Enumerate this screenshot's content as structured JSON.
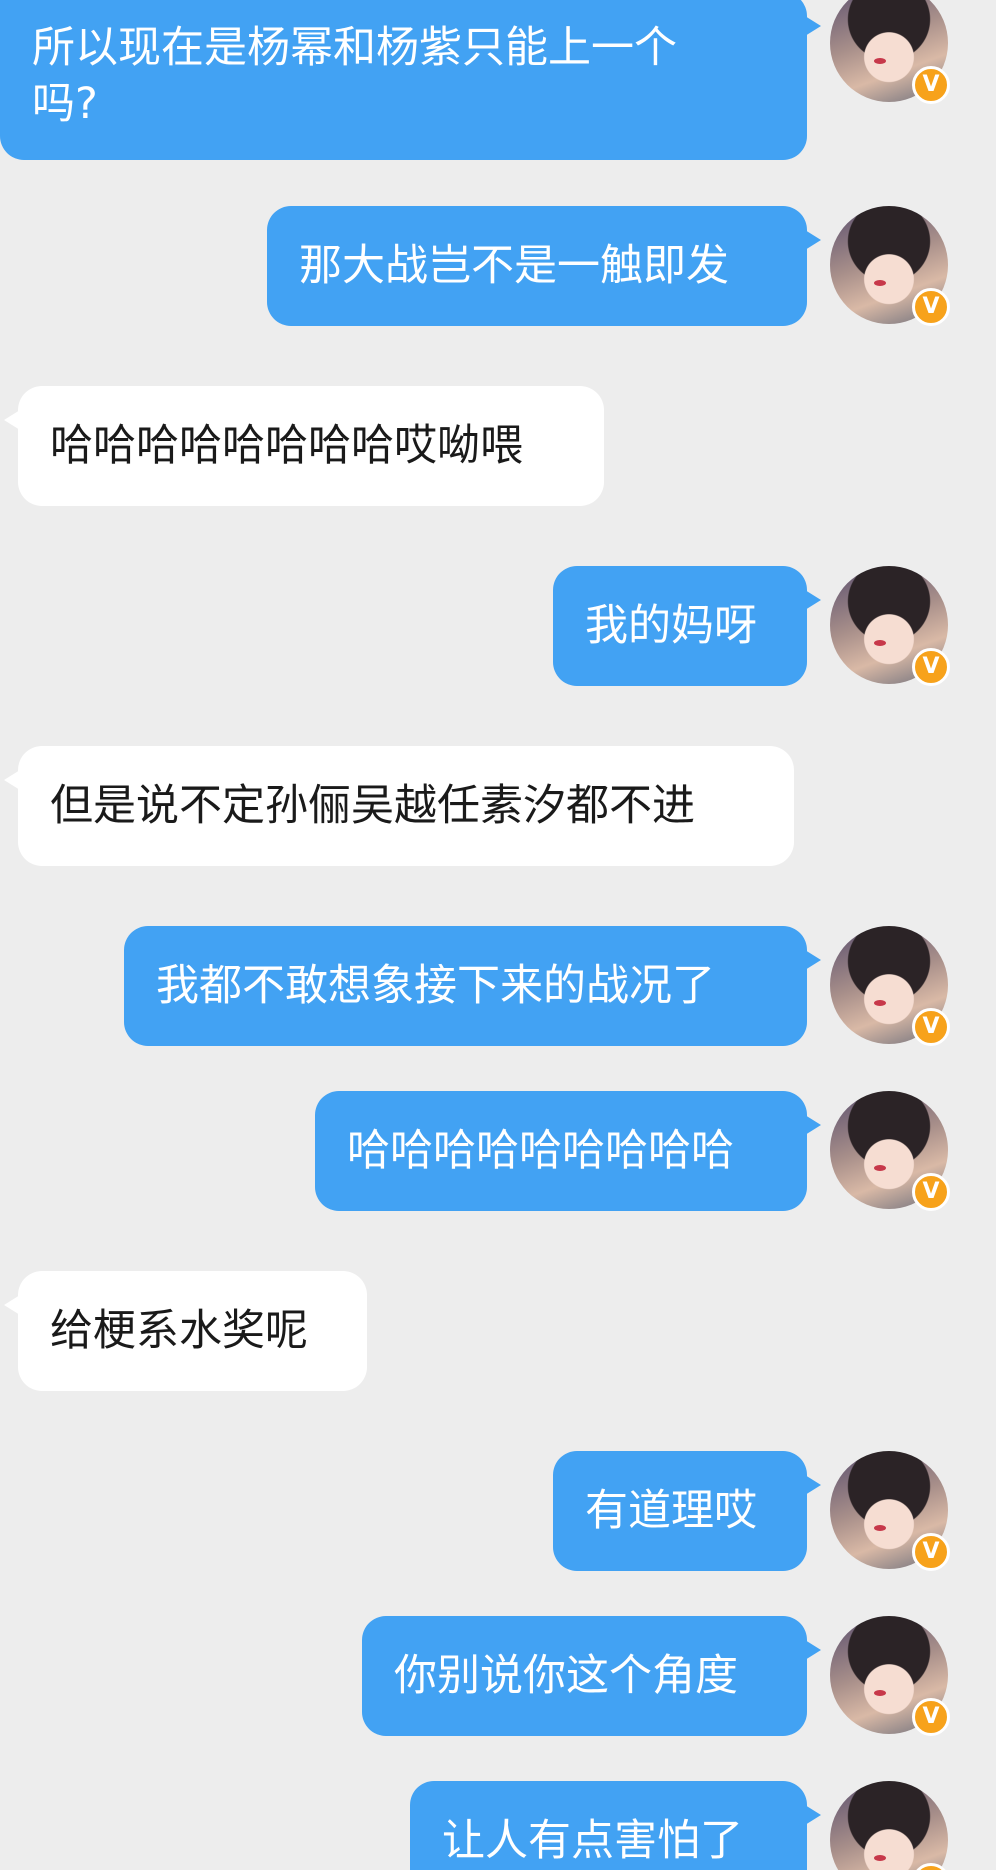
{
  "messages": [
    {
      "side": "outgoing",
      "text": "所以现在是杨幂和杨紫只能上一个\n吗?"
    },
    {
      "side": "outgoing",
      "text": "那大战岂不是一触即发"
    },
    {
      "side": "incoming",
      "text": "哈哈哈哈哈哈哈哈哎呦喂"
    },
    {
      "side": "outgoing",
      "text": "我的妈呀"
    },
    {
      "side": "incoming",
      "text": "但是说不定孙俪吴越任素汐都不进"
    },
    {
      "side": "outgoing",
      "text": "我都不敢想象接下来的战况了"
    },
    {
      "side": "outgoing",
      "text": "哈哈哈哈哈哈哈哈哈"
    },
    {
      "side": "incoming",
      "text": "给梗系水奖呢"
    },
    {
      "side": "outgoing",
      "text": "有道理哎"
    },
    {
      "side": "outgoing",
      "text": "你别说你这个角度"
    },
    {
      "side": "outgoing",
      "text": "让人有点害怕了"
    }
  ],
  "avatar": {
    "badge_icon": "verified-v-badge-icon",
    "badge_text": "V"
  },
  "colors": {
    "outgoing_bubble": "#42a2f3",
    "incoming_bubble": "#ffffff",
    "background": "#ededed",
    "badge": "#f7a21b"
  }
}
